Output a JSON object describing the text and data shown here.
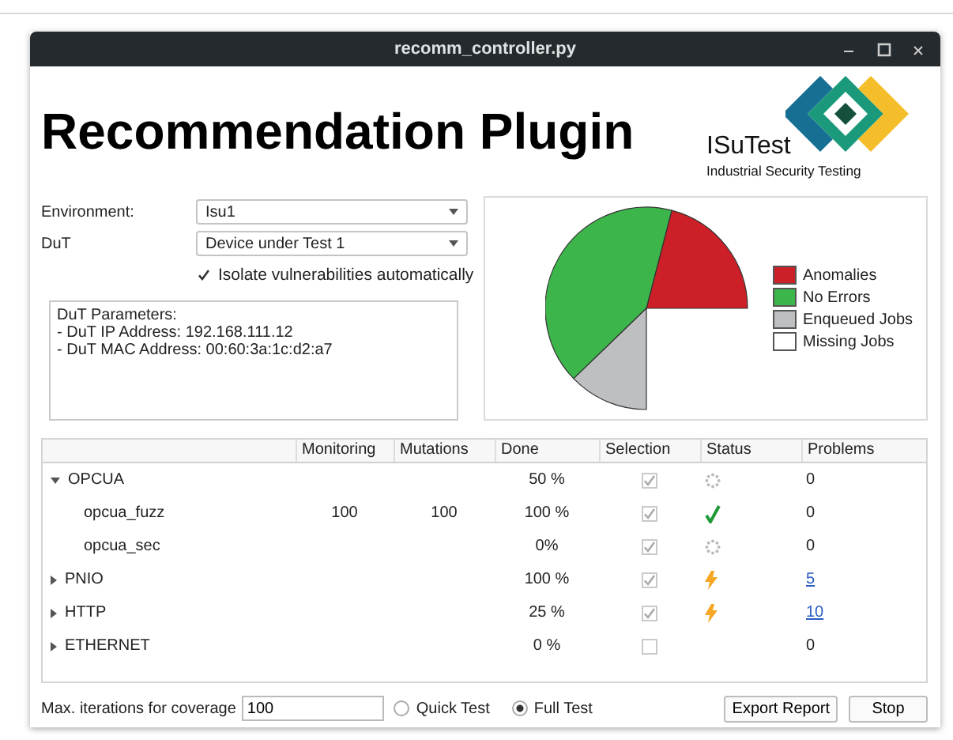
{
  "window": {
    "title": "recomm_controller.py"
  },
  "heading": "Recommendation Plugin",
  "logo": {
    "name": "ISuTest",
    "tagline": "Industrial Security Testing"
  },
  "form": {
    "environment": {
      "label": "Environment:",
      "value": "Isu1"
    },
    "dut": {
      "label": "DuT",
      "value": "Device under Test 1"
    },
    "isolate": {
      "label": "Isolate vulnerabilities automatically",
      "checked": true
    }
  },
  "parameters": [
    "DuT Parameters:",
    "- DuT IP Address: 192.168.111.12",
    "- DuT MAC Address: 00:60:3a:1c:d2:a7"
  ],
  "legend": [
    {
      "label": "Anomalies",
      "color": "#cc1f27"
    },
    {
      "label": "No Errors",
      "color": "#3cb54a"
    },
    {
      "label": "Enqueued Jobs",
      "color": "#bdbfc1"
    },
    {
      "label": "Missing Jobs",
      "color": "#ffffff"
    }
  ],
  "table": {
    "columns": [
      "Monitoring",
      "Mutations",
      "Done",
      "Selection",
      "Status",
      "Problems"
    ],
    "rows": [
      {
        "name": "OPCUA",
        "expanded": true,
        "done": "50 %",
        "selected": true,
        "kind": "pending",
        "problems": "0",
        "link": false,
        "children": [
          {
            "name": "opcua_fuzz",
            "monitoring": "100",
            "mutations": "100",
            "done": "100 %",
            "selected": true,
            "kind": "ok",
            "problems": "0",
            "link": false
          },
          {
            "name": "opcua_sec",
            "done": "0%",
            "selected": true,
            "kind": "pending",
            "problems": "0",
            "link": false
          }
        ]
      },
      {
        "name": "PNIO",
        "expanded": false,
        "done": "100 %",
        "selected": true,
        "kind": "warning",
        "problems": "5",
        "link": true
      },
      {
        "name": "HTTP",
        "expanded": false,
        "done": "25 %",
        "selected": true,
        "kind": "warning",
        "problems": "10",
        "link": true
      },
      {
        "name": "ETHERNET",
        "expanded": false,
        "done": "0 %",
        "selected": false,
        "problems": "0",
        "link": false
      }
    ]
  },
  "footer": {
    "iterations_label": "Max. iterations for coverage",
    "iterations_value": "100",
    "modes": [
      {
        "label": "Quick Test",
        "selected": false
      },
      {
        "label": "Full Test",
        "selected": true
      }
    ],
    "buttons": [
      "Export Report",
      "Stop"
    ]
  }
}
